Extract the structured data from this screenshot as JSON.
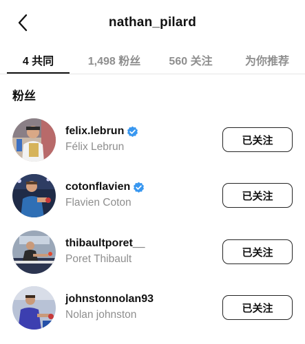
{
  "header": {
    "title": "nathan_pilard",
    "back_icon": "chevron-left-icon"
  },
  "tabs": [
    {
      "label": "4 共同",
      "active": true
    },
    {
      "label": "1,498 粉丝",
      "active": false
    },
    {
      "label": "560 关注",
      "active": false
    },
    {
      "label": "为你推荐",
      "active": false
    }
  ],
  "section": {
    "title": "粉丝"
  },
  "users": [
    {
      "username": "felix.lebrun",
      "full_name": "Félix Lebrun",
      "verified": true,
      "button_label": "已关注"
    },
    {
      "username": "cotonflavien",
      "full_name": "Flavien Coton",
      "verified": true,
      "button_label": "已关注"
    },
    {
      "username": "thibaultporet__",
      "full_name": "Poret Thibault",
      "verified": false,
      "button_label": "已关注"
    },
    {
      "username": "johnstonnolan93",
      "full_name": "Nolan johnston",
      "verified": false,
      "button_label": "已关注"
    }
  ],
  "colors": {
    "verified_badge": "#3897f0",
    "text_primary": "#111111",
    "text_secondary": "#8e8e8e"
  }
}
